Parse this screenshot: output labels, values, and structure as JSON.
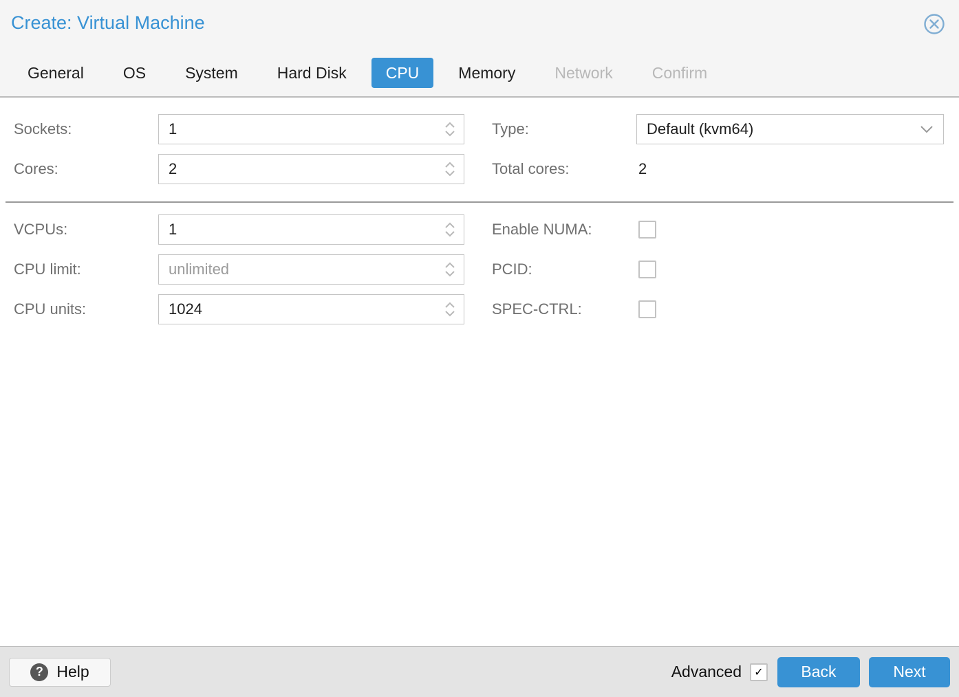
{
  "window": {
    "title": "Create: Virtual Machine"
  },
  "colors": {
    "accent_blue": "#3892d4",
    "header_bg": "#f5f5f5",
    "footer_bg": "#e4e4e4",
    "label_gray": "#6f6f6f",
    "disabled_tab_gray": "#b8b8b8",
    "close_icon_blue": "#7fadd3"
  },
  "icons": {
    "close": "circle-x-icon",
    "help_glyph": "?",
    "check_glyph": "✓",
    "spinner": "chevron-up-down-icons",
    "combo": "chevron-down-icon"
  },
  "tabs": [
    {
      "label": "General",
      "state": "normal"
    },
    {
      "label": "OS",
      "state": "normal"
    },
    {
      "label": "System",
      "state": "normal"
    },
    {
      "label": "Hard Disk",
      "state": "normal"
    },
    {
      "label": "CPU",
      "state": "active"
    },
    {
      "label": "Memory",
      "state": "normal"
    },
    {
      "label": "Network",
      "state": "disabled"
    },
    {
      "label": "Confirm",
      "state": "disabled"
    }
  ],
  "fields": {
    "sockets": {
      "label": "Sockets:",
      "value": "1",
      "type": "spinner"
    },
    "cores": {
      "label": "Cores:",
      "value": "2",
      "type": "spinner"
    },
    "type": {
      "label": "Type:",
      "value": "Default (kvm64)",
      "type": "combo"
    },
    "total_cores": {
      "label": "Total cores:",
      "value": "2",
      "type": "static"
    },
    "vcpus": {
      "label": "VCPUs:",
      "value": "1",
      "type": "spinner"
    },
    "cpu_limit": {
      "label": "CPU limit:",
      "value": "",
      "placeholder": "unlimited",
      "type": "spinner"
    },
    "cpu_units": {
      "label": "CPU units:",
      "value": "1024",
      "type": "spinner"
    },
    "enable_numa": {
      "label": "Enable NUMA:",
      "checked": false,
      "type": "checkbox"
    },
    "pcid": {
      "label": "PCID:",
      "checked": false,
      "type": "checkbox"
    },
    "spec_ctrl": {
      "label": "SPEC-CTRL:",
      "checked": false,
      "type": "checkbox"
    }
  },
  "footer": {
    "help_label": "Help",
    "advanced_label": "Advanced",
    "advanced_checked": true,
    "back_label": "Back",
    "next_label": "Next"
  }
}
